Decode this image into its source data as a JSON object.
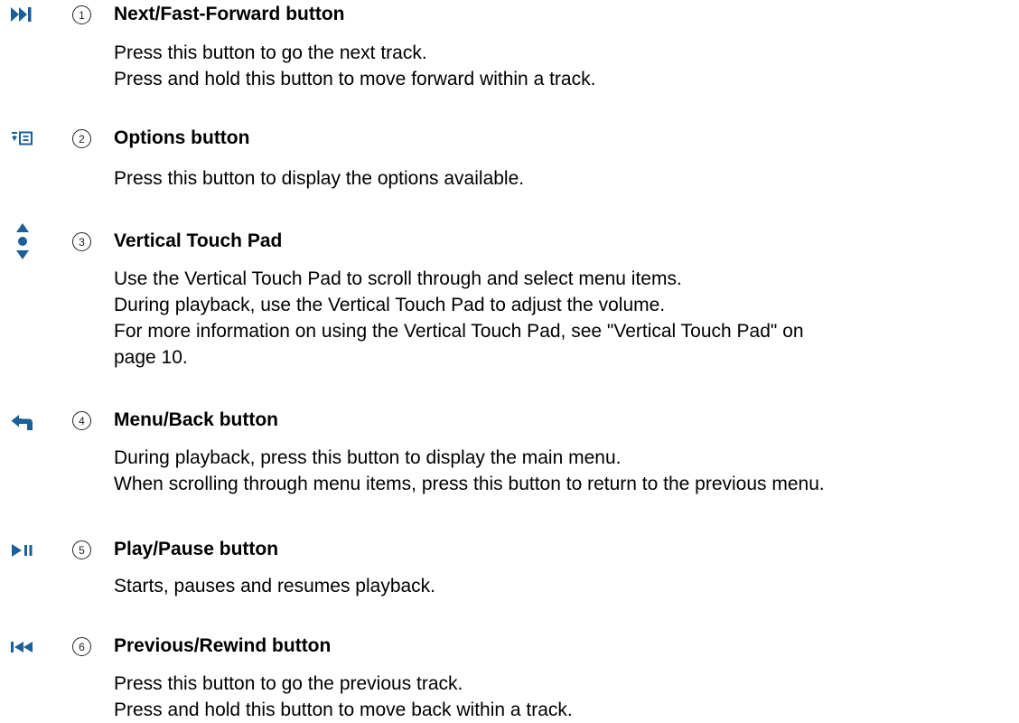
{
  "items": [
    {
      "number": "1",
      "icon": "next-fast-forward-icon",
      "title": "Next/Fast-Forward button",
      "lines": [
        "Press this button to go the next track.",
        "Press and hold this button to move forward within a track."
      ]
    },
    {
      "number": "2",
      "icon": "options-icon",
      "title": "Options button",
      "lines": [
        "Press this button to display the options available."
      ]
    },
    {
      "number": "3",
      "icon": "vertical-touch-pad-icon",
      "title": "Vertical Touch Pad",
      "lines": [
        "Use the Vertical Touch Pad to scroll through and select menu items.",
        "During playback, use the Vertical Touch Pad to adjust the volume.",
        "For more information on using the Vertical Touch Pad, see \"Vertical Touch Pad\" on",
        "page 10."
      ]
    },
    {
      "number": "4",
      "icon": "menu-back-icon",
      "title": "Menu/Back button",
      "lines": [
        "During playback, press this button to display the main menu.",
        "When scrolling through menu items, press this button to return to the previous menu."
      ]
    },
    {
      "number": "5",
      "icon": "play-pause-icon",
      "title": "Play/Pause button",
      "lines": [
        "Starts, pauses and resumes playback."
      ]
    },
    {
      "number": "6",
      "icon": "previous-rewind-icon",
      "title": "Previous/Rewind button",
      "lines": [
        "Press this button to go the previous track.",
        "Press and hold this button to move back within a track."
      ]
    }
  ],
  "colors": {
    "icon": "#1a5e9a",
    "text": "#000000"
  }
}
